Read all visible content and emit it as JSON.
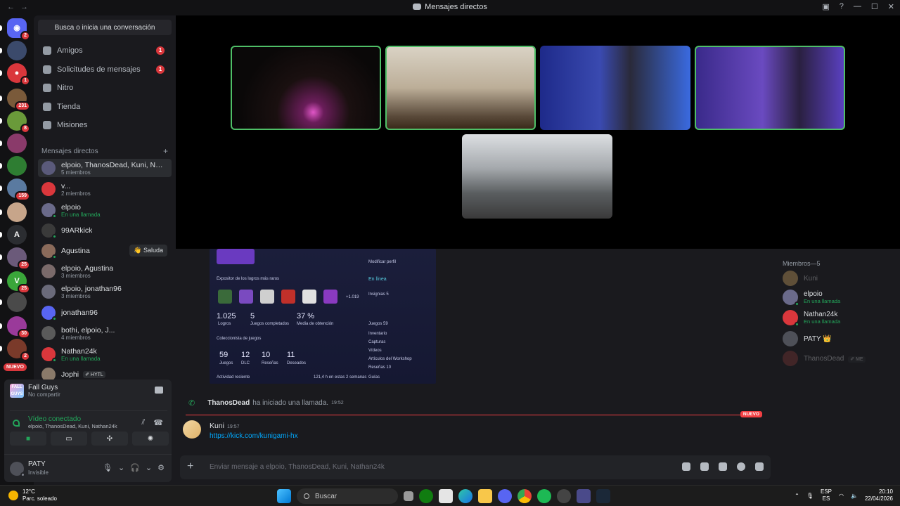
{
  "window": {
    "title": "Mensajes directos",
    "back": "←",
    "forward": "→",
    "inbox_icon": "inbox-icon",
    "help_icon": "help-icon",
    "min": "—",
    "max": "☐",
    "close": "✕"
  },
  "servers": [
    {
      "id": "home",
      "color": "#5865f2",
      "badge": "2",
      "glyph": "◉"
    },
    {
      "id": "s1",
      "color": "#3b4a6b",
      "badge": "",
      "glyph": ""
    },
    {
      "id": "s2",
      "color": "#da373c",
      "badge": "1",
      "glyph": "●"
    },
    {
      "id": "s3",
      "color": "#7a5a3a",
      "badge": "231",
      "glyph": ""
    },
    {
      "id": "s4",
      "color": "#6a9a3a",
      "badge": "8",
      "glyph": ""
    },
    {
      "id": "s5",
      "color": "#8a3a6a",
      "badge": "",
      "glyph": ""
    },
    {
      "id": "s6",
      "color": "#2e7d32",
      "badge": "",
      "glyph": ""
    },
    {
      "id": "s7",
      "color": "#5a7aa0",
      "badge": "159",
      "glyph": ""
    },
    {
      "id": "s8",
      "color": "#c7a58a",
      "badge": "",
      "glyph": ""
    },
    {
      "id": "s9",
      "color": "#2b2d31",
      "badge": "",
      "glyph": "A"
    },
    {
      "id": "s10",
      "color": "#6b5a7a",
      "badge": "25",
      "glyph": ""
    },
    {
      "id": "s11",
      "color": "#3aa63a",
      "badge": "25",
      "glyph": "V"
    },
    {
      "id": "s12",
      "color": "#4a4a4a",
      "badge": "",
      "glyph": ""
    },
    {
      "id": "s13",
      "color": "#9a3a9a",
      "badge": "30",
      "glyph": ""
    },
    {
      "id": "s14",
      "color": "#7a3a2a",
      "badge": "2",
      "glyph": ""
    }
  ],
  "nuevo_label": "NUEVO",
  "search": {
    "placeholder": "Busca o inicia una conversación"
  },
  "nav": [
    {
      "label": "Amigos",
      "count": "1",
      "icon": "friends-icon"
    },
    {
      "label": "Solicitudes de mensajes",
      "count": "1",
      "icon": "mail-icon"
    },
    {
      "label": "Nitro",
      "count": "",
      "icon": "nitro-icon"
    },
    {
      "label": "Tienda",
      "count": "",
      "icon": "shop-icon"
    },
    {
      "label": "Misiones",
      "count": "",
      "icon": "quests-icon"
    }
  ],
  "dm_header": {
    "label": "Mensajes directos",
    "plus": "+"
  },
  "dms": [
    {
      "name": "elpoio, ThanosDead, Kuni, Nathan24k",
      "sub": "5 miembros",
      "call": false,
      "color": "#5a5a7a",
      "active": true
    },
    {
      "name": "v...",
      "sub": "2 miembros",
      "call": false,
      "color": "#da373c"
    },
    {
      "name": "elpoio",
      "sub": "En una llamada",
      "call": true,
      "color": "#6a6a8a"
    },
    {
      "name": "99ARkick",
      "sub": "",
      "call": false,
      "color": "#3a3a3a"
    },
    {
      "name": "Agustina",
      "sub": "",
      "call": false,
      "color": "#8a6a5a"
    },
    {
      "name": "elpoio, Agustina",
      "sub": "3 miembros",
      "call": false,
      "color": "#7a6a6a"
    },
    {
      "name": "elpoio, jonathan96",
      "sub": "3 miembros",
      "call": false,
      "color": "#6a6a7a"
    },
    {
      "name": "jonathan96",
      "sub": "",
      "call": false,
      "color": "#5865f2"
    },
    {
      "name": "bothi, elpoio, J...",
      "sub": "4 miembros",
      "call": false,
      "color": "#5a5a5a"
    },
    {
      "name": "Nathan24k",
      "sub": "En una llamada",
      "call": true,
      "color": "#da373c"
    },
    {
      "name": "Jophi",
      "sub": "",
      "call": false,
      "color": "#8a7a6a"
    }
  ],
  "saluda": "👋 Saluda",
  "jophi_tag": "✐ HYTL",
  "game": {
    "name": "Fall Guys",
    "sub": "No compartir",
    "logo": "FALL GUYS"
  },
  "voice": {
    "status": "Vídeo conectado",
    "members": "elpoio, ThanosDead, Kuni, Nathan24k"
  },
  "user": {
    "name": "PATY",
    "status": "Invisible"
  },
  "chat": {
    "screenshot": {
      "section1": "Expositor de los logros más raros",
      "stat1": "1.025",
      "stat1_label": "Logros",
      "stat2": "5",
      "stat2_label": "Juegos completados",
      "stat3": "37 %",
      "stat3_label": "Media de obtención",
      "more": "+1.019",
      "section2": "Coleccionista de juegos",
      "c1": "59",
      "c1l": "Juegos",
      "c2": "12",
      "c2l": "DLC",
      "c3": "10",
      "c3l": "Reseñas",
      "c4": "11",
      "c4l": "Deseados",
      "recent": "Actividad reciente",
      "recent_hours": "121,4 h en estas 2 semanas",
      "modify": "Modificar perfil",
      "online": "En línea",
      "insignias": "Insignias",
      "insignias_n": "5",
      "juegos": "Juegos",
      "juegos_n": "59",
      "inventario": "Inventario",
      "capturas": "Capturas",
      "videos": "Vídeos",
      "workshop": "Artículos del Workshop",
      "resenas": "Reseñas",
      "resenas_n": "10",
      "guias": "Guías"
    },
    "call_msg": {
      "who": "ThanosDead",
      "what": "ha iniciado una llamada.",
      "time": "19:52"
    },
    "nuevo": "NUEVO",
    "message": {
      "who": "Kuni",
      "time": "19:57",
      "link": "https://kick.com/kunigami-hx"
    },
    "composer_placeholder": "Enviar mensaje a elpoio, ThanosDead, Kuni, Nathan24k"
  },
  "members": {
    "header": "Miembros—5",
    "list": [
      {
        "name": "Kuni",
        "sub": "",
        "off": true,
        "color": "#e0b36a"
      },
      {
        "name": "elpoio",
        "sub": "En una llamada",
        "off": false,
        "color": "#6a6a8a"
      },
      {
        "name": "Nathan24k",
        "sub": "En una llamada",
        "off": false,
        "color": "#da373c"
      },
      {
        "name": "PATY 👑",
        "sub": "",
        "off": false,
        "color": "#4e5058"
      },
      {
        "name": "ThanosDead",
        "sub": "",
        "off": true,
        "color": "#8a3a3a",
        "tag": "✐ ME"
      }
    ]
  },
  "taskbar": {
    "temp": "12°C",
    "weather": "Parc. soleado",
    "search": "Buscar",
    "lang1": "ESP",
    "lang2": "ES",
    "time": "20:10",
    "date": "22/04/2026"
  }
}
